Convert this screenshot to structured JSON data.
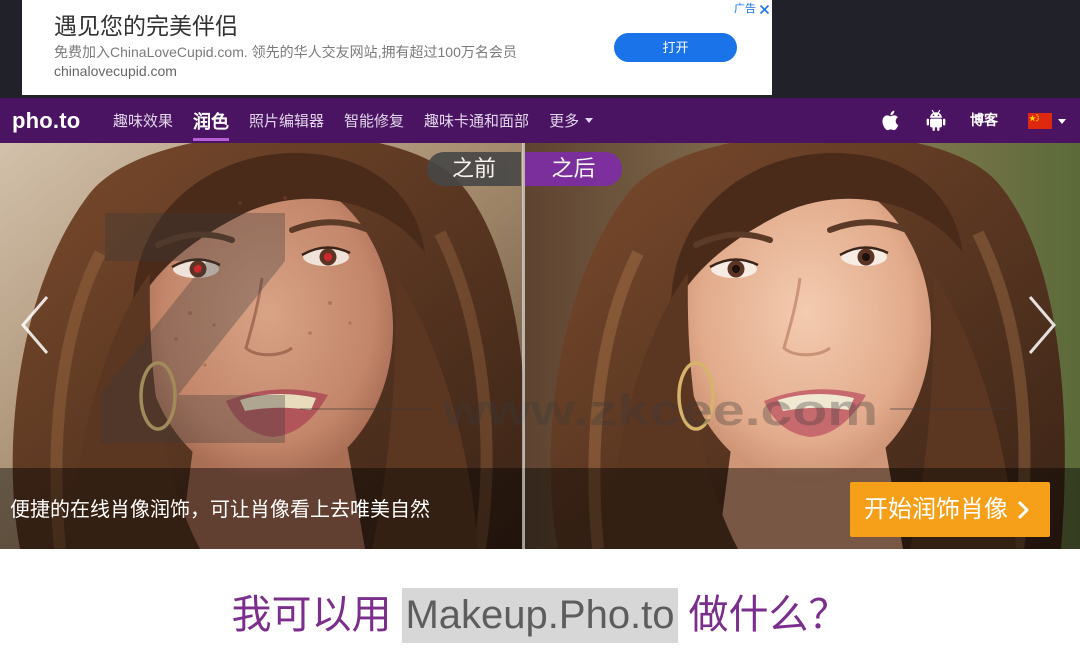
{
  "ad": {
    "title": "遇见您的完美伴侣",
    "description": "免费加入ChinaLoveCupid.com. 领先的华人交友网站,拥有超过100万名会员",
    "url": "chinalovecupid.com",
    "button": "打开",
    "badge": "广告",
    "close_icon": "close-icon"
  },
  "nav": {
    "logo": "pho.to",
    "items": [
      {
        "label": "趣味效果",
        "active": false
      },
      {
        "label": "润色",
        "active": true
      },
      {
        "label": "照片编辑器",
        "active": false
      },
      {
        "label": "智能修复",
        "active": false
      },
      {
        "label": "趣味卡通和面部",
        "active": false
      },
      {
        "label": "更多",
        "active": false,
        "icon": "chevron-down-icon"
      }
    ],
    "blog": "博客",
    "icons": [
      "apple-icon",
      "android-icon",
      "china-flag-icon",
      "chevron-down-icon"
    ]
  },
  "hero": {
    "before_label": "之前",
    "after_label": "之后",
    "caption": "便捷的在线肖像润饰，可让肖像看上去唯美自然",
    "cta": "开始润饰肖像",
    "cta_icon": "chevron-right-icon",
    "prev_icon": "chevron-left-icon",
    "next_icon": "chevron-right-icon"
  },
  "watermark": {
    "url": "www.zkcee.com"
  },
  "section": {
    "heading_before": "我可以用",
    "heading_brand": "Makeup.Pho.to",
    "heading_after": "做什么？"
  },
  "colors": {
    "topbar_bg": "#202129",
    "nav_bg": "#4a1462",
    "nav_active_underline": "#b45fd6",
    "cta_bg": "#f6a01a",
    "heading": "#7b2e8c",
    "ad_button": "#1a73e8",
    "after_pill": "#7d2ea3",
    "before_pill": "#474747",
    "brand_highlight": "#d7d7d7"
  }
}
